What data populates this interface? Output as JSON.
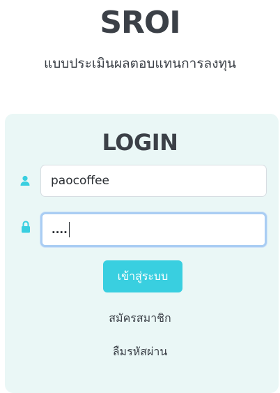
{
  "header": {
    "title": "SROI",
    "subtitle": "แบบประเมินผลตอบแทนการลงทุน"
  },
  "login": {
    "heading": "LOGIN",
    "username_value": "paocoffee",
    "password_masked": "....",
    "submit_label": "เข้าสู่ระบบ",
    "register_link": "สมัครสมาชิก",
    "forgot_link": "ลืมรหัสผ่าน"
  },
  "icons": {
    "username": "user-icon",
    "password": "lock-icon"
  },
  "colors": {
    "title_text": "#3b4047",
    "card_bg": "#eaf7f6",
    "accent": "#39cfe0",
    "focus_border": "#a9cdf3"
  }
}
